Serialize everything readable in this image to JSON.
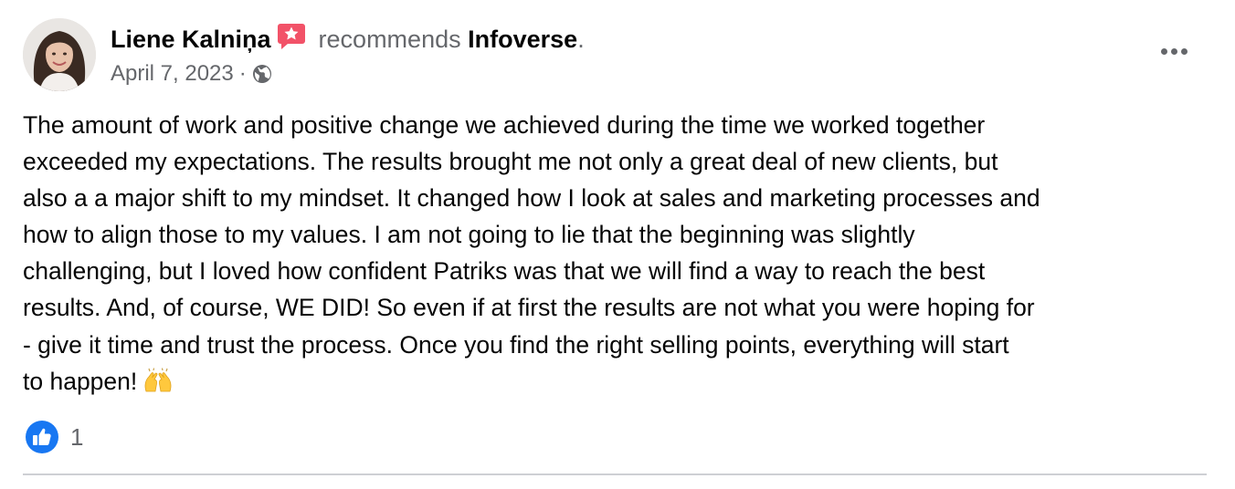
{
  "post": {
    "author": "Liene Kalniņa",
    "recommends_text": "recommends",
    "page_name": "Infoverse",
    "period": ".",
    "date": "April 7, 2023",
    "separator": "·",
    "privacy_icon": "globe-icon",
    "badge_icon": "recommendation-star-icon",
    "more_icon": "more-horizontal-icon",
    "body_lines": [
      "The amount of work and positive change we achieved during the time we worked together",
      "exceeded my expectations. The results brought me not only a great deal of new clients, but",
      "also a a major shift to my mindset. It changed how I look at sales and marketing processes and",
      "how to align those to my values. I am not going to lie that the beginning was slightly",
      "challenging, but I loved how confident Patriks was that we will find a way to reach the best",
      "results. And, of course, WE DID! So even if at first the results are not what you were hoping for",
      "- give it time and trust the process. Once you find the right selling points, everything will start",
      "to happen!"
    ],
    "body_emoji": "raising-hands-emoji",
    "reactions": {
      "icon": "like-icon",
      "count": "1"
    }
  },
  "colors": {
    "text_primary": "#050505",
    "text_secondary": "#65676b",
    "like_blue": "#1877f2",
    "badge_pink": "#f25268",
    "divider": "#ced0d4"
  }
}
